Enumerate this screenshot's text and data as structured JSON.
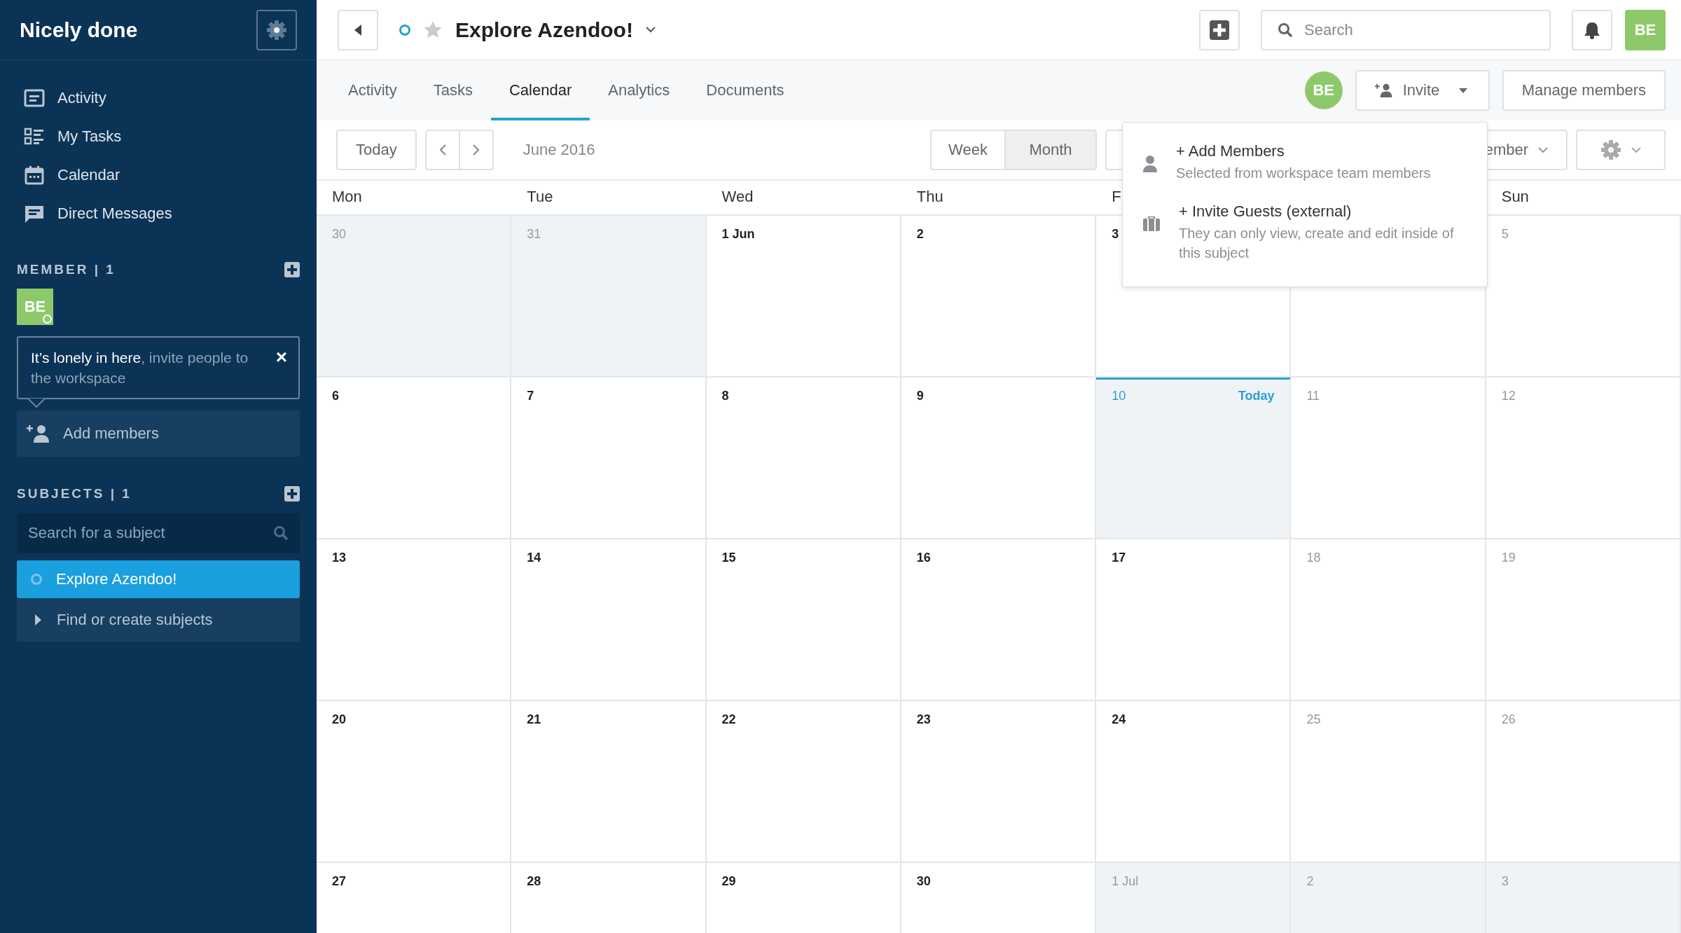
{
  "sidebar": {
    "workspace": "Nicely done",
    "nav": [
      "Activity",
      "My Tasks",
      "Calendar",
      "Direct Messages"
    ],
    "member_heading": "MEMBER | 1",
    "member_avatar": {
      "initials": "BE",
      "online": true
    },
    "hint": {
      "text": "**It’s lonely in here**, invite people to the workspace",
      "close": "×"
    },
    "add_members": "Add members",
    "subjects_heading": "SUBJECTS | 1",
    "subject_search": {
      "placeholder": "Search for a subject"
    },
    "subjects": [
      {
        "label": "Explore Azendoo!",
        "selected": true
      }
    ],
    "find_subjects": "Find or create subjects"
  },
  "header": {
    "title": "Explore Azendoo!",
    "starred": false,
    "search": {
      "placeholder": "Search"
    },
    "avatar": "BE"
  },
  "tabs": [
    {
      "label": "Activity",
      "selected": false
    },
    {
      "label": "Tasks",
      "selected": false
    },
    {
      "label": "Calendar",
      "selected": true
    },
    {
      "label": "Analytics",
      "selected": false
    },
    {
      "label": "Documents",
      "selected": false
    }
  ],
  "members_bar": {
    "avatar": "BE",
    "invite": "Invite",
    "manage": "Manage members"
  },
  "toolbar": {
    "today": "Today",
    "period": "June 2016",
    "views": [
      {
        "label": "Week",
        "selected": false
      },
      {
        "label": "Month",
        "selected": true
      }
    ],
    "filter": "ember"
  },
  "invite_menu": [
    {
      "title": "+ Add Members",
      "subtitle": "Selected from workspace team members"
    },
    {
      "title": "+ Invite Guests (external)",
      "subtitle": "They can only view, create and edit inside of this subject"
    }
  ],
  "calendar": {
    "weekdays": [
      "Mon",
      "Tue",
      "Wed",
      "Thu",
      "F"
    ],
    "weekend_days": [
      "Sun"
    ],
    "weeks": [
      [
        {
          "day": "30",
          "kind": "outside"
        },
        {
          "day": "31",
          "kind": "outside"
        },
        {
          "day": "1 Jun",
          "kind": "weekday"
        },
        {
          "day": "2",
          "kind": "weekday"
        },
        {
          "day": "3",
          "kind": "weekday"
        },
        {
          "kind": "weekend"
        },
        {
          "day": "5",
          "kind": "weekend"
        }
      ],
      [
        {
          "day": "6",
          "kind": "weekday"
        },
        {
          "day": "7",
          "kind": "weekday"
        },
        {
          "day": "8",
          "kind": "weekday"
        },
        {
          "day": "9",
          "kind": "weekday"
        },
        {
          "day": "10",
          "kind": "today",
          "label": "Today"
        },
        {
          "day": "11",
          "kind": "weekend"
        },
        {
          "day": "12",
          "kind": "weekend"
        }
      ],
      [
        {
          "day": "13",
          "kind": "weekday"
        },
        {
          "day": "14",
          "kind": "weekday"
        },
        {
          "day": "15",
          "kind": "weekday"
        },
        {
          "day": "16",
          "kind": "weekday"
        },
        {
          "day": "17",
          "kind": "weekday"
        },
        {
          "day": "18",
          "kind": "weekend"
        },
        {
          "day": "19",
          "kind": "weekend"
        }
      ],
      [
        {
          "day": "20",
          "kind": "weekday"
        },
        {
          "day": "21",
          "kind": "weekday"
        },
        {
          "day": "22",
          "kind": "weekday"
        },
        {
          "day": "23",
          "kind": "weekday"
        },
        {
          "day": "24",
          "kind": "weekday"
        },
        {
          "day": "25",
          "kind": "weekend"
        },
        {
          "day": "26",
          "kind": "weekend"
        }
      ],
      [
        {
          "day": "27",
          "kind": "weekday"
        },
        {
          "day": "28",
          "kind": "weekday"
        },
        {
          "day": "29",
          "kind": "weekday"
        },
        {
          "day": "30",
          "kind": "weekday"
        },
        {
          "day": "1 Jul",
          "kind": "outside"
        },
        {
          "day": "2",
          "kind": "outside"
        },
        {
          "day": "3",
          "kind": "outside"
        }
      ]
    ]
  }
}
